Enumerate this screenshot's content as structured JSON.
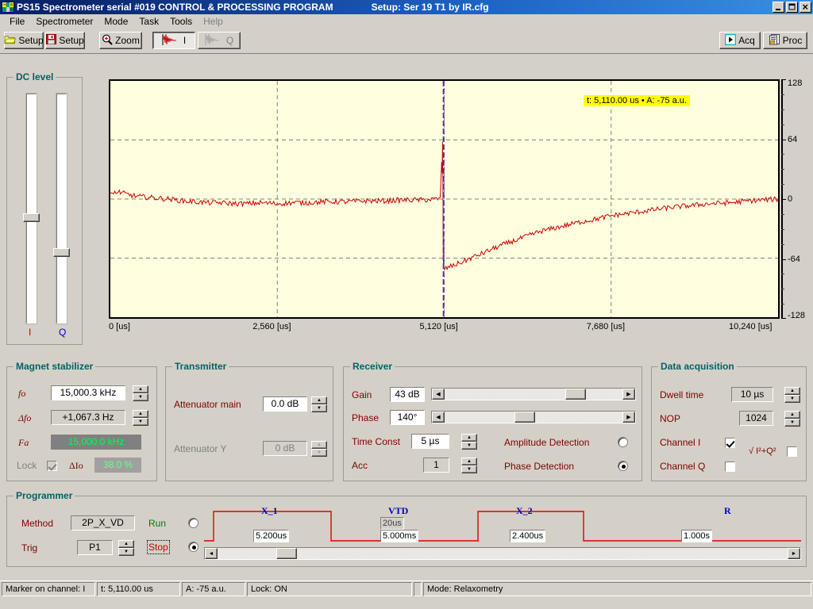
{
  "window": {
    "title": "PS15 Spectrometer serial #019   CONTROL & PROCESSING PROGRAM",
    "setup_label": "Setup: Ser 19 T1 by IR.cfg",
    "minimize": "_",
    "maximize": "▭",
    "close": "×"
  },
  "menu": {
    "items": [
      {
        "label": "File",
        "enabled": true
      },
      {
        "label": "Spectrometer",
        "enabled": true
      },
      {
        "label": "Mode",
        "enabled": true
      },
      {
        "label": "Task",
        "enabled": true
      },
      {
        "label": "Tools",
        "enabled": true
      },
      {
        "label": "Help",
        "enabled": false
      }
    ]
  },
  "toolbar": {
    "open_setup": "Setup",
    "save_setup": "Setup",
    "zoom": "Zoom",
    "channel_i": "I",
    "channel_q": "Q",
    "acq": "Acq",
    "proc": "Proc"
  },
  "dc_level": {
    "legend": "DC level",
    "i_label": "I",
    "q_label": "Q",
    "i_value_pct": 54,
    "q_value_pct": 70
  },
  "chart_data": {
    "type": "line",
    "title": "",
    "xlabel": "[us]",
    "ylabel": "a.u.",
    "xlim": [
      0,
      10240
    ],
    "ylim": [
      -128,
      128
    ],
    "xticks": [
      0,
      2560,
      5120,
      7680,
      10240
    ],
    "xtick_labels": [
      "0 [us]",
      "2,560 [us]",
      "5,120 [us]",
      "7,680 [us]",
      "10,240 [us]"
    ],
    "yticks": [
      -128,
      -64,
      0,
      64,
      128
    ],
    "ytick_labels": [
      "-128",
      "-64",
      "0",
      "64",
      "128"
    ],
    "grid": true,
    "plot_bg": "#ffffe0",
    "trace_color": "#cc0000",
    "marker_color": "#603090",
    "marker_x": 5110,
    "tooltip": "t: 5,110.00 us • A: -75 a.u.",
    "series": [
      {
        "name": "Channel I",
        "description": "Inversion recovery FID: flat noise baseline near 0, sharp positive spike then drop to -75 a.u. at the 5,110 us pulse, followed by exponential recovery toward 0.",
        "points": [
          [
            0,
            6
          ],
          [
            120,
            8
          ],
          [
            260,
            5
          ],
          [
            400,
            3
          ],
          [
            560,
            2
          ],
          [
            720,
            1
          ],
          [
            900,
            0
          ],
          [
            1100,
            -2
          ],
          [
            1300,
            -3
          ],
          [
            1500,
            -4
          ],
          [
            1700,
            -4
          ],
          [
            1900,
            -5
          ],
          [
            2100,
            -5
          ],
          [
            2300,
            -4
          ],
          [
            2560,
            -5
          ],
          [
            2800,
            -4
          ],
          [
            3000,
            -4
          ],
          [
            3300,
            -3
          ],
          [
            3600,
            -3
          ],
          [
            3900,
            -2
          ],
          [
            4200,
            -2
          ],
          [
            4500,
            -1
          ],
          [
            4800,
            -1
          ],
          [
            5020,
            0
          ],
          [
            5060,
            2
          ],
          [
            5080,
            40
          ],
          [
            5090,
            28
          ],
          [
            5095,
            62
          ],
          [
            5100,
            10
          ],
          [
            5105,
            -60
          ],
          [
            5110,
            -75
          ],
          [
            5130,
            -76
          ],
          [
            5180,
            -74
          ],
          [
            5260,
            -72
          ],
          [
            5400,
            -68
          ],
          [
            5600,
            -62
          ],
          [
            5800,
            -56
          ],
          [
            6000,
            -50
          ],
          [
            6200,
            -45
          ],
          [
            6400,
            -40
          ],
          [
            6600,
            -35
          ],
          [
            6900,
            -30
          ],
          [
            7200,
            -25
          ],
          [
            7500,
            -21
          ],
          [
            7680,
            -18
          ],
          [
            8000,
            -15
          ],
          [
            8300,
            -12
          ],
          [
            8600,
            -9
          ],
          [
            8900,
            -7
          ],
          [
            9200,
            -5
          ],
          [
            9500,
            -4
          ],
          [
            9800,
            -2
          ],
          [
            10000,
            -1
          ],
          [
            10240,
            0
          ]
        ]
      }
    ]
  },
  "magnet": {
    "legend": "Magnet stabilizer",
    "fo_label": "fo",
    "fo_value": "15,000.3 kHz",
    "dfo_label": "Δfo",
    "dfo_value": "+1,067.3 Hz",
    "fa_label": "Fa",
    "fa_value": "15,000.0 kHz",
    "lock_label": "Lock",
    "lock_checked": true,
    "dio_label": "ΔIo",
    "dio_value": "38.0 %"
  },
  "transmitter": {
    "legend": "Transmitter",
    "att_main_label": "Attenuator main",
    "att_main_value": "0.0 dB",
    "att_y_label": "Attenuator Y",
    "att_y_value": "0 dB"
  },
  "receiver": {
    "legend": "Receiver",
    "gain_label": "Gain",
    "gain_value": "43 dB",
    "gain_pct": 76,
    "phase_label": "Phase",
    "phase_value": "140°",
    "phase_pct": 44,
    "timeconst_label": "Time Const",
    "timeconst_value": "5 µs",
    "acc_label": "Acc",
    "acc_value": "1",
    "amplitude_detection": "Amplitude Detection",
    "phase_detection": "Phase Detection",
    "detection_selected": "phase"
  },
  "dataacq": {
    "legend": "Data acquisition",
    "dwell_label": "Dwell time",
    "dwell_value": "10 µs",
    "nop_label": "NOP",
    "nop_value": "1024",
    "chan_i_label": "Channel I",
    "chan_i_checked": true,
    "chan_q_label": "Channel Q",
    "chan_q_checked": false,
    "magnitude_label": "√ I²+Q²",
    "magnitude_checked": false
  },
  "programmer": {
    "legend": "Programmer",
    "method_label": "Method",
    "method_value": "2P_X_VD",
    "trig_label": "Trig",
    "trig_value": "P1",
    "run_label": "Run",
    "stop_label": "Stop",
    "state_selected": "stop",
    "pulses": [
      {
        "name": "X_1",
        "values": [
          "5.200us"
        ]
      },
      {
        "name": "VTD",
        "values": [
          "20us",
          "5.000ms"
        ]
      },
      {
        "name": "X_2",
        "values": [
          "2.400us"
        ]
      },
      {
        "name": "R",
        "values": [
          "1.000s"
        ]
      }
    ],
    "scroll_arrow_left": "◄",
    "scroll_arrow_right": "►"
  },
  "statusbar": {
    "panes": [
      "Marker on channel:  I",
      "t: 5,110.00 us",
      "A: -75 a.u.",
      "Lock: ON",
      "",
      "Mode: Relaxometry"
    ]
  }
}
